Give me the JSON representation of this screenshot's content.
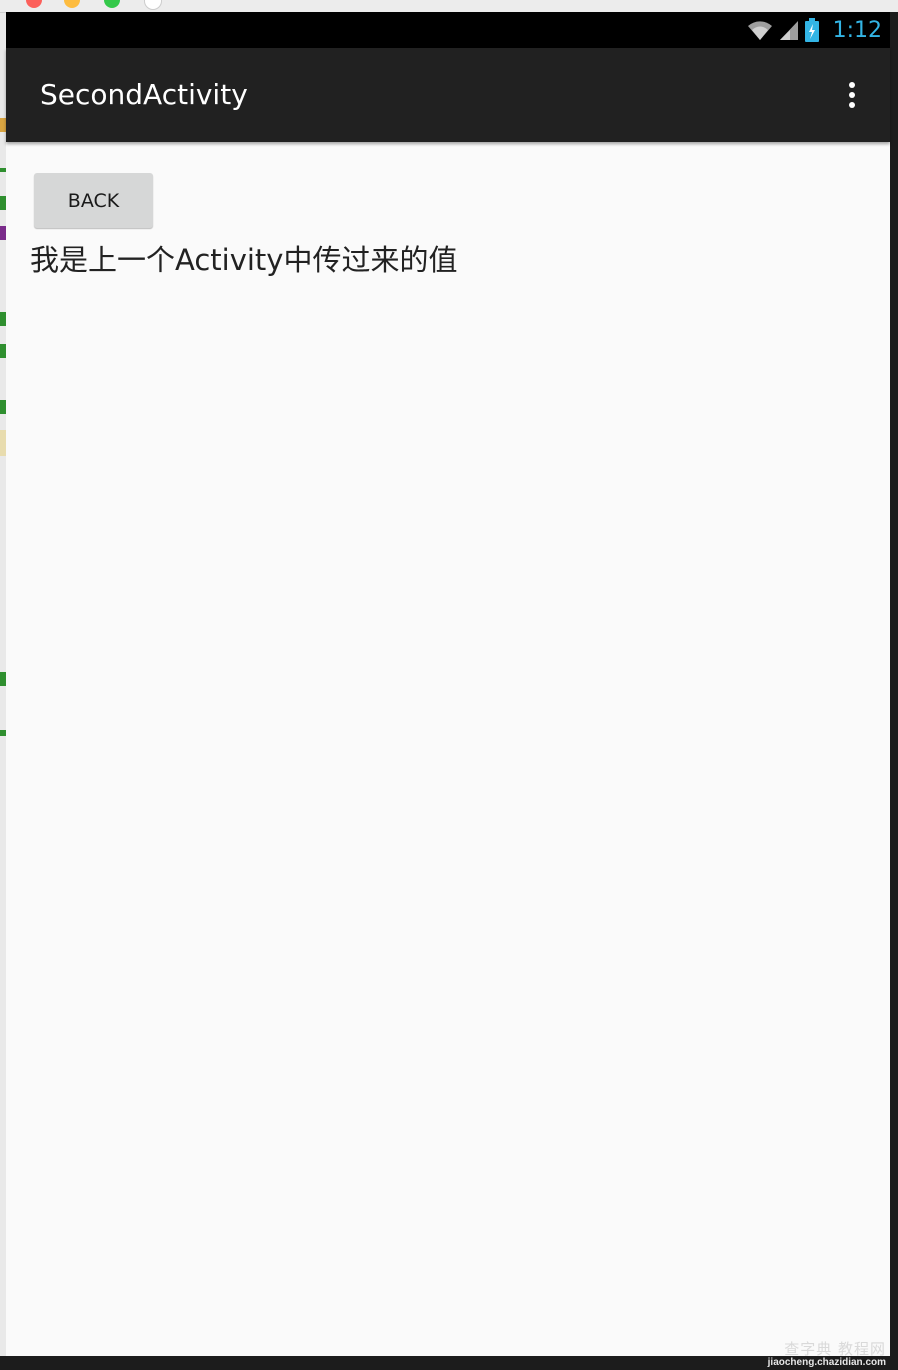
{
  "status_bar": {
    "time": "1:12",
    "icons": [
      "wifi-icon",
      "cell-signal-icon",
      "battery-charging-icon"
    ],
    "time_color": "#33b5e5"
  },
  "action_bar": {
    "title": "SecondActivity",
    "menu_icon": "overflow-menu-icon",
    "background": "#212121"
  },
  "content": {
    "back_button_label": "BACK",
    "message": "我是上一个Activity中传过来的值"
  },
  "watermark": {
    "site_cn": "查字典 教程网",
    "site_url": "jiaocheng.chazidian.com"
  }
}
